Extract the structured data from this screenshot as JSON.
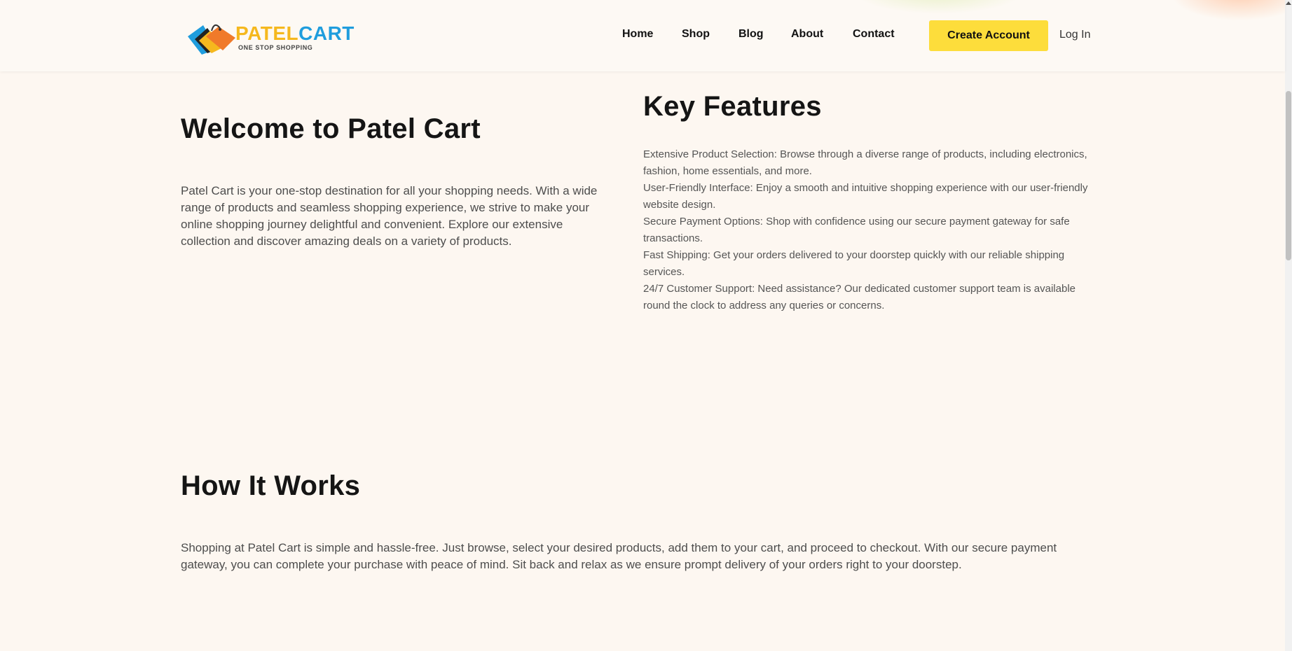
{
  "brand": {
    "name_part1": "PATEL",
    "name_part2": "CART",
    "tagline": "ONE STOP SHOPPING",
    "colors": {
      "yellow": "#f5b81e",
      "blue": "#1f9ddd",
      "orange": "#f07a2a"
    }
  },
  "nav": {
    "items": [
      {
        "label": "Home"
      },
      {
        "label": "Shop"
      },
      {
        "label": "Blog"
      },
      {
        "label": "About"
      },
      {
        "label": "Contact"
      }
    ],
    "create_account": "Create Account",
    "login": "Log In"
  },
  "welcome": {
    "title": "Welcome to Patel Cart",
    "text": "Patel Cart is your one-stop destination for all your shopping needs. With a wide range of products and seamless shopping experience, we strive to make your online shopping journey delightful and convenient. Explore our extensive collection and discover amazing deals on a variety of products."
  },
  "features": {
    "title": "Key Features",
    "items": [
      "Extensive Product Selection: Browse through a diverse range of products, including electronics, fashion, home essentials, and more.",
      "User-Friendly Interface: Enjoy a smooth and intuitive shopping experience with our user-friendly website design.",
      "Secure Payment Options: Shop with confidence using our secure payment gateway for safe transactions.",
      "Fast Shipping: Get your orders delivered to your doorstep quickly with our reliable shipping services.",
      "24/7 Customer Support: Need assistance? Our dedicated customer support team is available round the clock to address any queries or concerns."
    ]
  },
  "how_it_works": {
    "title": "How It Works",
    "text": "Shopping at Patel Cart is simple and hassle-free. Just browse, select your desired products, add them to your cart, and proceed to checkout. With our secure payment gateway, you can complete your purchase with peace of mind. Sit back and relax as we ensure prompt delivery of your orders right to your doorstep."
  },
  "colors": {
    "accent_button": "#fddd3b",
    "page_bg": "#fdf7f1"
  }
}
